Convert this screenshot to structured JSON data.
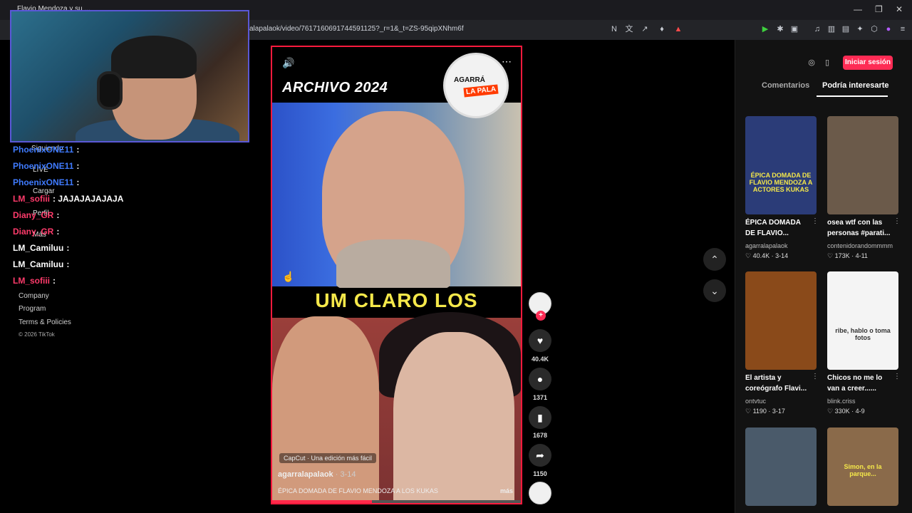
{
  "browser": {
    "tab_title": "Flavio Mendoza y su ...",
    "url": "alapalaok/video/7617160691744591125?_r=1&_t=ZS-95qipXNhm6f"
  },
  "left": {
    "nav": [
      "Siguiendo",
      "LIVE",
      "Cargar",
      "Perfil",
      "Más"
    ],
    "footer": [
      "Company",
      "Program",
      "Terms & Policies",
      "© 2026 TikTok"
    ]
  },
  "chat": [
    {
      "user": "PhoenixONE11",
      "msg": ":",
      "color": "#3f7bff"
    },
    {
      "user": "PhoenixONE11",
      "msg": ":",
      "color": "#3f7bff"
    },
    {
      "user": "PhoenixONE11",
      "msg": ":",
      "color": "#3f7bff"
    },
    {
      "user": "LM_sofiii",
      "msg": ": JAJAJAJAJAJA",
      "color": "#ff3b6b"
    },
    {
      "user": "Diany_GR",
      "msg": ":",
      "color": "#ff3b6b"
    },
    {
      "user": "Diany_GR",
      "msg": ":",
      "color": "#ff3b6b"
    },
    {
      "user": "LM_Camiluu",
      "msg": ":",
      "color": "#ffffff"
    },
    {
      "user": "LM_Camiluu",
      "msg": ":",
      "color": "#ffffff"
    },
    {
      "user": "LM_sofiii",
      "msg": ":",
      "color": "#ff3b6b"
    }
  ],
  "video": {
    "title": "ARCHIVO 2024",
    "logo_text_top": "AGARRÁ",
    "logo_text_bottom": "LA PALA",
    "subtitle": "UM CLARO LOS",
    "capcut": "CapCut · Una edición más fácil",
    "author": "agarralapalaok",
    "date": "· 3-14",
    "caption": "ÉPICA DOMADA DE FLAVIO MENDOZA A LOS KUKAS",
    "more": "más",
    "progress": 0.4
  },
  "actions": {
    "likes": "40.4K",
    "comments": "1371",
    "saves": "1678",
    "shares": "1150"
  },
  "panel": {
    "login": "Iniciar sesión",
    "tabs": [
      "Comentarios",
      "Podría interesarte"
    ],
    "cards": [
      {
        "title": "ÉPICA DOMADA DE FLAVIO...",
        "user": "agarralapalaok",
        "stats": "♡ 40.4K · 3-14",
        "thumb_text": "ÉPICA DOMADA DE FLAVIO MENDOZA A ACTORES KUKAS",
        "color": "#2b3c78"
      },
      {
        "title": "osea wtf con las personas #parati...",
        "user": "contenidorandommmm",
        "stats": "♡ 173K · 4-11",
        "thumb_text": "",
        "color": "#6b5a4a"
      },
      {
        "title": "El artista y coreógrafo Flavi...",
        "user": "ontvtuc",
        "stats": "♡ 1190 · 3-17",
        "thumb_text": "",
        "color": "#8a4a1a"
      },
      {
        "title": "Chicos no me lo van a creer......",
        "user": "blink.criss",
        "stats": "♡ 330K · 4-9",
        "thumb_text": "ribe, hablo o toma fotos",
        "color": "#f4f4f4"
      },
      {
        "title": "",
        "user": "",
        "stats": "",
        "thumb_text": "",
        "color": "#4a5a6a"
      },
      {
        "title": "",
        "user": "",
        "stats": "",
        "thumb_text": "Simon, en la parque...",
        "color": "#8a6a4a"
      }
    ]
  }
}
